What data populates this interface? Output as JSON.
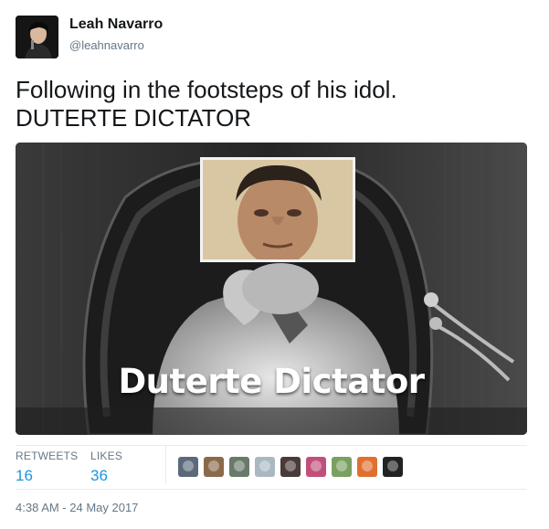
{
  "tweet": {
    "author_name": "Leah Navarro",
    "author_handle": "@leahnavarro",
    "text_line1": "Following in the footsteps of his idol.",
    "text_line2": "DUTERTE DICTATOR",
    "media_caption": "Duterte Dictator",
    "stats": {
      "retweets_label": "RETWEETS",
      "retweets_value": "16",
      "likes_label": "LIKES",
      "likes_value": "36"
    },
    "likers": [
      {
        "name": "liker-1",
        "color": "#5a6a7a"
      },
      {
        "name": "liker-2",
        "color": "#8a6a4a"
      },
      {
        "name": "liker-3",
        "color": "#6a7a6a"
      },
      {
        "name": "liker-4",
        "color": "#aab8c2"
      },
      {
        "name": "liker-5",
        "color": "#4a3a3a"
      },
      {
        "name": "liker-6",
        "color": "#c0507a"
      },
      {
        "name": "liker-7",
        "color": "#7aa060"
      },
      {
        "name": "liker-8",
        "color": "#e07030"
      },
      {
        "name": "liker-9",
        "color": "#222222"
      }
    ],
    "timestamp": "4:38 AM - 24 May 2017"
  }
}
